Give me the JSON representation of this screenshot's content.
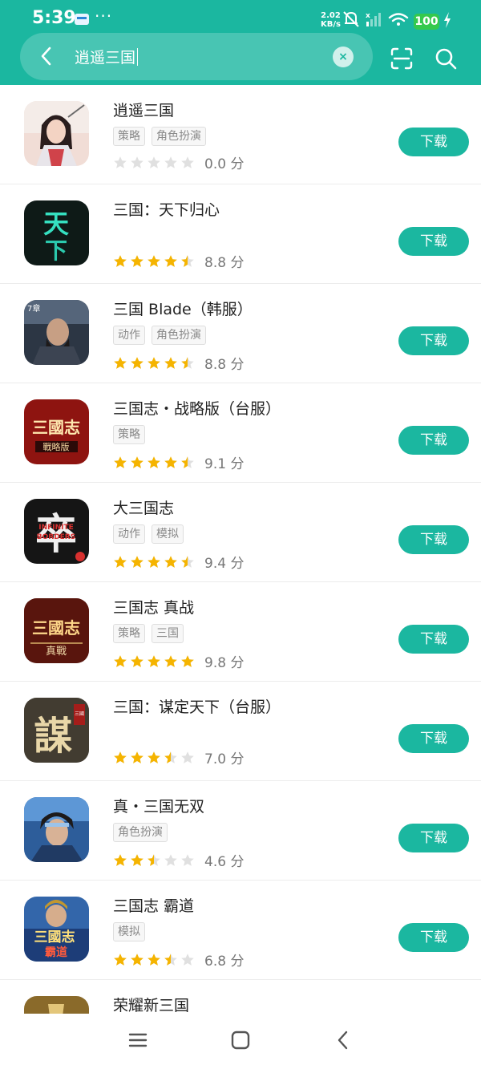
{
  "status_bar": {
    "time": "5:39",
    "more": "···",
    "net_speed_value": "2.02",
    "net_speed_unit": "KB/s",
    "battery": "100"
  },
  "search": {
    "query": "逍遥三国",
    "clear_symbol": "×"
  },
  "colors": {
    "accent": "#1bb7a0",
    "star_filled": "#f5b400",
    "star_empty": "#e0e0e0"
  },
  "download_label": "下载",
  "score_unit": "分",
  "apps": [
    {
      "title": "逍遥三国",
      "tags": [
        "策略",
        "角色扮演"
      ],
      "stars": 0,
      "score": "0.0",
      "icon": "xiaoyao-sanguo-icon",
      "icon_bg": "#f1ddd6"
    },
    {
      "title": "三国：天下归心",
      "tags": [],
      "stars": 4.5,
      "score": "8.8",
      "icon": "tianxia-guixin-icon",
      "icon_bg": "#0e1a17"
    },
    {
      "title": "三国 Blade（韩服）",
      "tags": [
        "动作",
        "角色扮演"
      ],
      "stars": 4.5,
      "score": "8.8",
      "icon": "sanguo-blade-icon",
      "icon_bg": "#2c3644"
    },
    {
      "title": "三国志・战略版（台服）",
      "tags": [
        "策略"
      ],
      "stars": 4.5,
      "score": "9.1",
      "icon": "sanguozhi-zhanlue-icon",
      "icon_bg": "#8e1410"
    },
    {
      "title": "大三国志",
      "tags": [
        "动作",
        "模拟"
      ],
      "stars": 4.5,
      "score": "9.4",
      "icon": "da-sanguozhi-icon",
      "icon_bg": "#151515"
    },
    {
      "title": "三国志 真战",
      "tags": [
        "策略",
        "三国"
      ],
      "stars": 5,
      "score": "9.8",
      "icon": "sanguozhi-zhenzhan-icon",
      "icon_bg": "#3a0d08"
    },
    {
      "title": "三国：谋定天下（台服）",
      "tags": [],
      "stars": 3.5,
      "score": "7.0",
      "icon": "mouding-tianxia-icon",
      "icon_bg": "#2a2620"
    },
    {
      "title": "真・三国无双",
      "tags": [
        "角色扮演"
      ],
      "stars": 2.5,
      "score": "4.6",
      "icon": "sanguo-wushuang-icon",
      "icon_bg": "#2d5d9a"
    },
    {
      "title": "三国志 霸道",
      "tags": [
        "模拟"
      ],
      "stars": 3.5,
      "score": "6.8",
      "icon": "sanguozhi-badao-icon",
      "icon_bg": "#3366aa"
    },
    {
      "title": "荣耀新三国",
      "tags": [],
      "stars": 0,
      "score": "",
      "icon": "rongyao-xin-sanguo-icon",
      "icon_bg": "#8a6a2a"
    }
  ],
  "icon_chars": {
    "a1": "天",
    "a2": "下",
    "a3": "7章",
    "a4": "三國志",
    "a5": "戰略版",
    "a6": "卒",
    "a7": "INFINITE",
    "a8": "BORDERS",
    "a9": "三國志",
    "a10": "真戰",
    "a11": "謀",
    "a12": "三國",
    "a13": "三國志",
    "a14": "霸道"
  }
}
